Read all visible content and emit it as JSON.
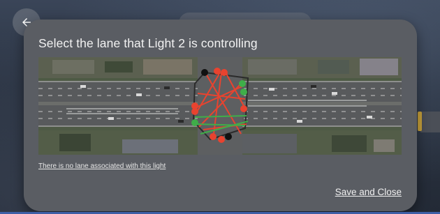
{
  "dialog": {
    "title": "Select the lane that Light 2 is controlling",
    "no_lane_link": "There is no lane associated with this light",
    "save_button": "Save and Close"
  },
  "colors": {
    "dialog_bg": "#5a5d63",
    "lane_red": "#e8432f",
    "lane_green": "#3fae49"
  },
  "icons": {
    "back": "arrow-left-icon"
  }
}
